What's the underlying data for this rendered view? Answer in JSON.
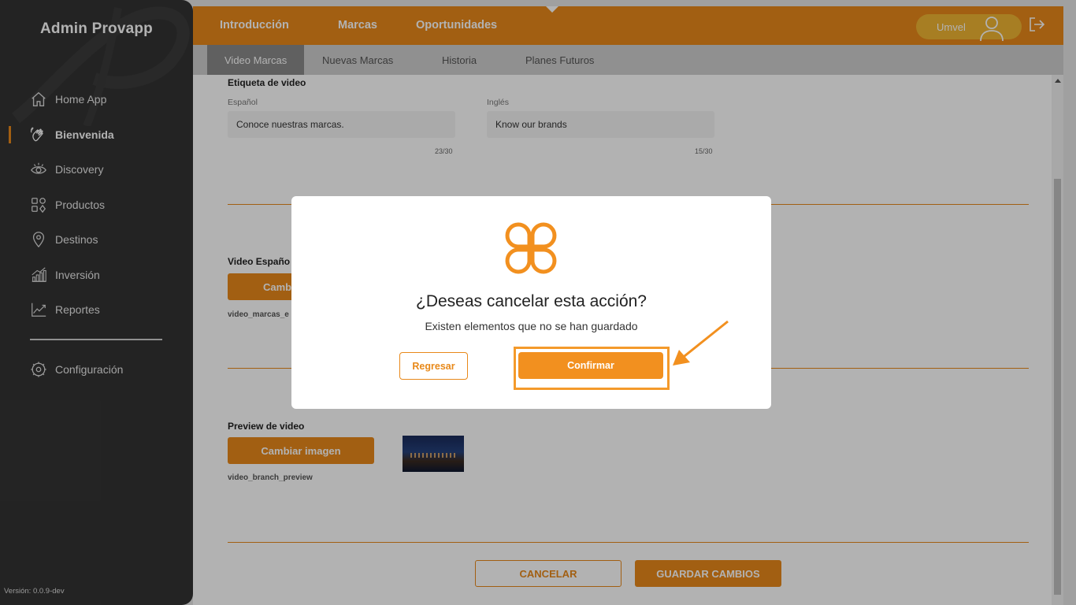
{
  "app": {
    "title": "Admin Provapp",
    "version": "Versión: 0.0.9-dev"
  },
  "sidebar": {
    "items": [
      {
        "label": "Home App",
        "icon": "home-icon"
      },
      {
        "label": "Bienvenida",
        "icon": "waving-hand-icon",
        "active": true
      },
      {
        "label": "Discovery",
        "icon": "eye-icon"
      },
      {
        "label": "Productos",
        "icon": "grid-shapes-icon"
      },
      {
        "label": "Destinos",
        "icon": "location-pin-icon"
      },
      {
        "label": "Inversión",
        "icon": "bar-chart-icon"
      },
      {
        "label": "Reportes",
        "icon": "line-chart-icon"
      }
    ],
    "config_label": "Configuración"
  },
  "header": {
    "tabs": [
      {
        "label": "Introducción"
      },
      {
        "label": "Marcas",
        "active": true
      },
      {
        "label": "Oportunidades"
      }
    ],
    "user_label": "Umvel"
  },
  "subnav": {
    "tabs": [
      {
        "label": "Video Marcas",
        "active": true
      },
      {
        "label": "Nuevas Marcas"
      },
      {
        "label": "Historia"
      },
      {
        "label": "Planes Futuros"
      }
    ]
  },
  "form": {
    "video_label_title": "Etiqueta de video",
    "spanish_label": "Español",
    "spanish_value": "Conoce nuestras marcas.",
    "spanish_count": "23/30",
    "english_label": "Inglés",
    "english_value": "Know our brands",
    "english_count": "15/30",
    "video_es_title": "Video Españo",
    "video_es_button": "Camb",
    "video_es_file": "video_marcas_e",
    "preview_title": "Preview de video",
    "preview_button": "Cambiar imagen",
    "preview_file": "video_branch_preview",
    "cancel_button": "CANCELAR",
    "save_button": "GUARDAR CAMBIOS"
  },
  "modal": {
    "title": "¿Deseas cancelar esta acción?",
    "subtitle": "Existen elementos que no se han guardado",
    "back_button": "Regresar",
    "confirm_button": "Confirmar"
  },
  "colors": {
    "accent": "#e8891a",
    "sidebar": "#333333",
    "confirm": "#f2901f"
  }
}
